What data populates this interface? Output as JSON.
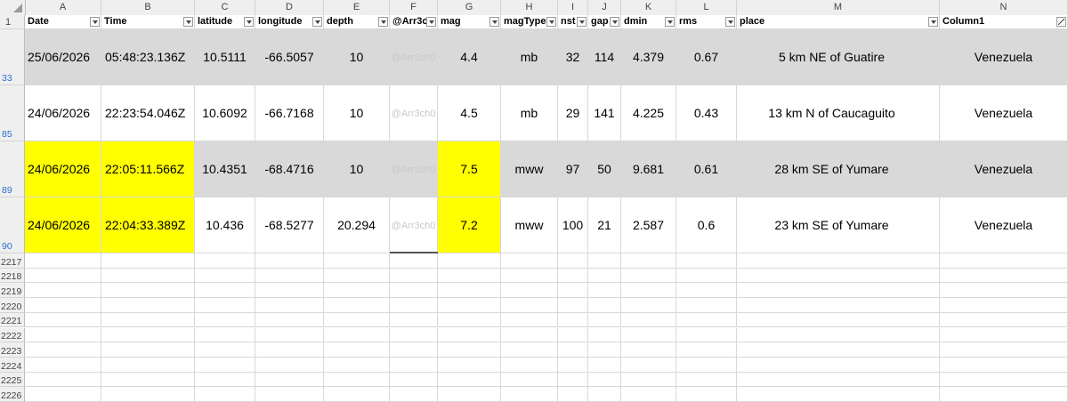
{
  "columns": [
    {
      "letter": "A",
      "header": "Date"
    },
    {
      "letter": "B",
      "header": "Time"
    },
    {
      "letter": "C",
      "header": "latitude"
    },
    {
      "letter": "D",
      "header": "longitude"
    },
    {
      "letter": "E",
      "header": "depth"
    },
    {
      "letter": "F",
      "header": "@Arr3c"
    },
    {
      "letter": "G",
      "header": "mag"
    },
    {
      "letter": "H",
      "header": "magType"
    },
    {
      "letter": "I",
      "header": "nst"
    },
    {
      "letter": "J",
      "header": "gap"
    },
    {
      "letter": "K",
      "header": "dmin"
    },
    {
      "letter": "L",
      "header": "rms"
    },
    {
      "letter": "M",
      "header": "place"
    },
    {
      "letter": "N",
      "header": "Column1"
    }
  ],
  "header_row_number": "1",
  "rows": [
    {
      "row_number": "33",
      "values": [
        "25/06/2026",
        "05:48:23.136Z",
        "10.5111",
        "-66.5057",
        "10",
        "@Arr3ch0",
        "4.4",
        "mb",
        "32",
        "114",
        "4.379",
        "0.67",
        "5 km NE of Guatire",
        "Venezuela"
      ]
    },
    {
      "row_number": "85",
      "values": [
        "24/06/2026",
        "22:23:54.046Z",
        "10.6092",
        "-66.7168",
        "10",
        "@Arr3ch0",
        "4.5",
        "mb",
        "29",
        "141",
        "4.225",
        "0.43",
        "13 km N of Caucaguito",
        "Venezuela"
      ]
    },
    {
      "row_number": "89",
      "values": [
        "24/06/2026",
        "22:05:11.566Z",
        "10.4351",
        "-68.4716",
        "10",
        "@Arr3ch0",
        "7.5",
        "mww",
        "97",
        "50",
        "9.681",
        "0.61",
        "28 km SE of Yumare",
        "Venezuela"
      ]
    },
    {
      "row_number": "90",
      "values": [
        "24/06/2026",
        "22:04:33.389Z",
        "10.436",
        "-68.5277",
        "20.294",
        "@Arr3ch0",
        "7.2",
        "mww",
        "100",
        "21",
        "2.587",
        "0.6",
        "23 km SE of Yumare",
        "Venezuela"
      ]
    }
  ],
  "empty_row_numbers": [
    "2217",
    "2218",
    "2219",
    "2220",
    "2221",
    "2222",
    "2223",
    "2224",
    "2225",
    "2226"
  ],
  "colors": {
    "highlight": "#ffff00",
    "band": "#d9d9d9",
    "filtered_row_number": "#2a6fcf"
  }
}
